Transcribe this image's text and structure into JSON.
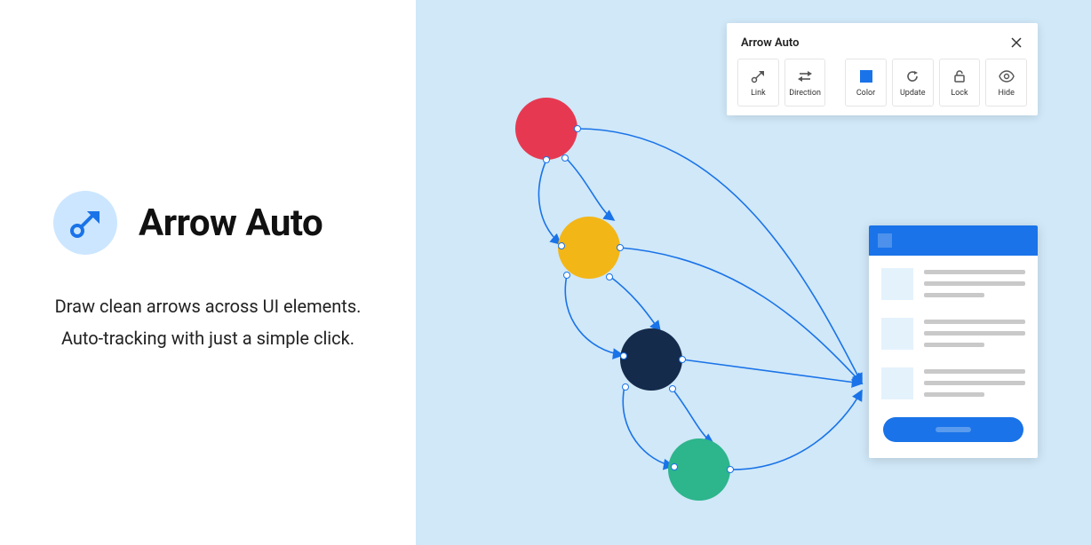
{
  "app": {
    "title": "Arrow Auto",
    "subtitle_line1": "Draw clean arrows across UI elements.",
    "subtitle_line2": "Auto-tracking with just a simple click."
  },
  "panel": {
    "title": "Arrow Auto",
    "buttons": [
      {
        "id": "link",
        "label": "Link",
        "icon": "arrow-link-icon"
      },
      {
        "id": "direction",
        "label": "Direction",
        "icon": "direction-icon"
      },
      {
        "id": "color",
        "label": "Color",
        "icon": "color-swatch-icon"
      },
      {
        "id": "update",
        "label": "Update",
        "icon": "refresh-icon"
      },
      {
        "id": "lock",
        "label": "Lock",
        "icon": "lock-icon"
      },
      {
        "id": "hide",
        "label": "Hide",
        "icon": "eye-icon"
      }
    ]
  },
  "colors": {
    "arrow": "#1a73e8",
    "node_red": "#e63951",
    "node_gold": "#f3b617",
    "node_navy": "#142b4c",
    "node_teal": "#2db58c",
    "canvas_bg": "#d0e8f8",
    "logo_bg": "#cce6ff"
  }
}
